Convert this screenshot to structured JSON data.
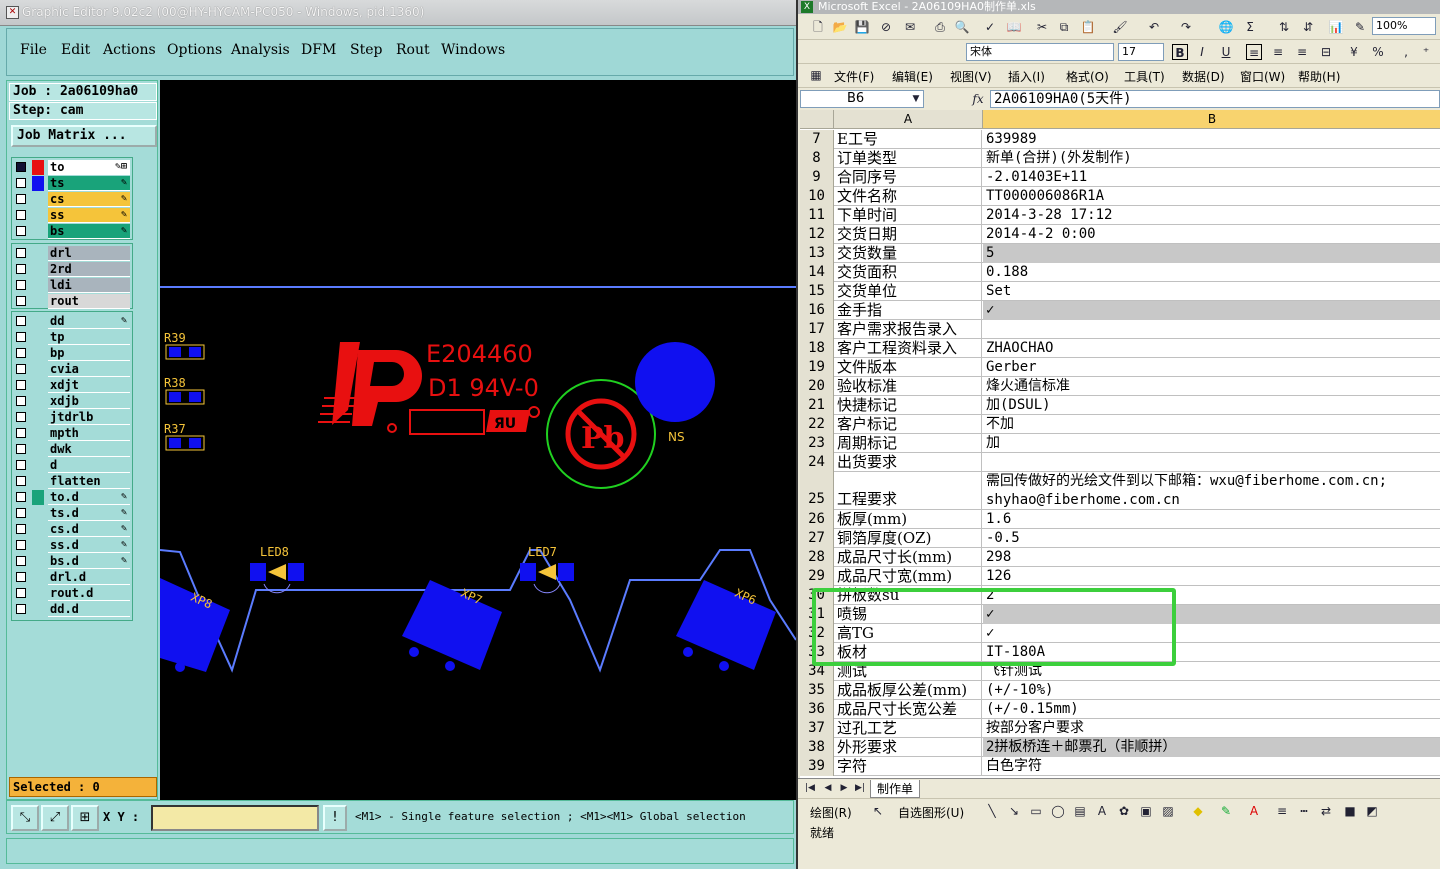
{
  "ge": {
    "title": "Graphic Editor 9.02c2 (00@HY-HYCAM-PC050 - Windows, pid:1360)",
    "menu": [
      "File",
      "Edit",
      "Actions",
      "Options",
      "Analysis",
      "DFM",
      "Step",
      "Rout",
      "Windows"
    ],
    "job": "Job : 2a06109ha0",
    "step": "Step: cam",
    "job_matrix": "Job Matrix ...",
    "layers_a": [
      "to",
      "ts",
      "cs",
      "ss",
      "bs"
    ],
    "layers_b": [
      "drl",
      "2rd",
      "ldi",
      "rout"
    ],
    "layers_c": [
      "dd",
      "tp",
      "bp",
      "cvia",
      "xdjt",
      "xdjb",
      "jtdrlb",
      "mpth",
      "dwk",
      "d",
      "flatten",
      "to.d",
      "ts.d",
      "cs.d",
      "ss.d",
      "bs.d",
      "drl.d",
      "rout.d",
      "dd.d"
    ],
    "selected": "Selected : 0",
    "xy_label": "X Y :",
    "xy_value": "",
    "message": "<M1> - Single feature selection ; <M1><M1> Global selection",
    "canvas": {
      "ul_code": "E204460",
      "rating": "D1  94V-0",
      "pb": "Pb",
      "ns": "NS",
      "refs": [
        "R39",
        "R38",
        "R37",
        "LED8",
        "LED7",
        "XP8",
        "XP7",
        "XP6"
      ]
    },
    "colors": {
      "panel": "#9fd8d6",
      "red": "#e81010",
      "blue": "#1010f0",
      "green": "#20d020",
      "yellow": "#f5c43a"
    }
  },
  "xl": {
    "title": "Microsoft Excel - 2A06109HA0制作单.xls",
    "font_name": "宋体",
    "font_size": "17",
    "zoom": "100%",
    "menu": [
      "文件(F)",
      "编辑(E)",
      "视图(V)",
      "插入(I)",
      "格式(O)",
      "工具(T)",
      "数据(D)",
      "窗口(W)",
      "帮助(H)"
    ],
    "name_box": "B6",
    "fx": "fx",
    "formula": "2A06109HA0(5天件)",
    "col_a": "A",
    "col_b": "B",
    "rows": [
      {
        "n": "7",
        "a": "E工号",
        "b": "639989"
      },
      {
        "n": "8",
        "a": "订单类型",
        "b": "新单(合拼)(外发制作)"
      },
      {
        "n": "9",
        "a": "合同序号",
        "b": "-2.01403E+11"
      },
      {
        "n": "10",
        "a": "文件名称",
        "b": "TT000006086R1A"
      },
      {
        "n": "11",
        "a": "下单时间",
        "b": "2014-3-28 17:12"
      },
      {
        "n": "12",
        "a": "交货日期",
        "b": "2014-4-2 0:00"
      },
      {
        "n": "13",
        "a": "交货数量",
        "b": "5"
      },
      {
        "n": "14",
        "a": "交货面积",
        "b": "0.188"
      },
      {
        "n": "15",
        "a": "交货单位",
        "b": "Set"
      },
      {
        "n": "16",
        "a": "金手指",
        "b": "✓"
      },
      {
        "n": "17",
        "a": "客户需求报告录入",
        "b": ""
      },
      {
        "n": "18",
        "a": "客户工程资料录入",
        "b": "ZHAOCHAO"
      },
      {
        "n": "19",
        "a": "文件版本",
        "b": "Gerber"
      },
      {
        "n": "20",
        "a": "验收标准",
        "b": "烽火通信标准"
      },
      {
        "n": "21",
        "a": "快捷标记",
        "b": "加(DSUL)"
      },
      {
        "n": "22",
        "a": "客户标记",
        "b": "不加"
      },
      {
        "n": "23",
        "a": "周期标记",
        "b": "加"
      },
      {
        "n": "24",
        "a": "出货要求",
        "b": ""
      },
      {
        "n": "25",
        "a": "工程要求",
        "b": "需回传做好的光绘文件到以下邮箱：wxu@fiberhome.com.cn; shyhao@fiberhome.com.cn"
      },
      {
        "n": "26",
        "a": "板厚(mm)",
        "b": "1.6"
      },
      {
        "n": "27",
        "a": "铜箔厚度(OZ)",
        "b": "-0.5"
      },
      {
        "n": "28",
        "a": "成品尺寸长(mm)",
        "b": "298"
      },
      {
        "n": "29",
        "a": "成品尺寸宽(mm)",
        "b": "126"
      },
      {
        "n": "30",
        "a": "拼板数su",
        "b": "2"
      },
      {
        "n": "31",
        "a": "喷锡",
        "b": "✓"
      },
      {
        "n": "32",
        "a": "高TG",
        "b": "✓"
      },
      {
        "n": "33",
        "a": "板材",
        "b": "IT-180A"
      },
      {
        "n": "34",
        "a": "测试",
        "b": "飞针测试"
      },
      {
        "n": "35",
        "a": "成品板厚公差(mm)",
        "b": "(+/-10%)"
      },
      {
        "n": "36",
        "a": "成品尺寸长宽公差",
        "b": "(+/-0.15mm)"
      },
      {
        "n": "37",
        "a": "过孔工艺",
        "b": "按部分客户要求"
      },
      {
        "n": "38",
        "a": "外形要求",
        "b": "2拼板桥连＋邮票孔（非顺拼）"
      },
      {
        "n": "39",
        "a": "字符",
        "b": "白色字符"
      }
    ],
    "sheet_tab": "制作单",
    "draw_label": "绘图(R)",
    "autoshape_label": "自选图形(U)",
    "status": "就绪"
  }
}
